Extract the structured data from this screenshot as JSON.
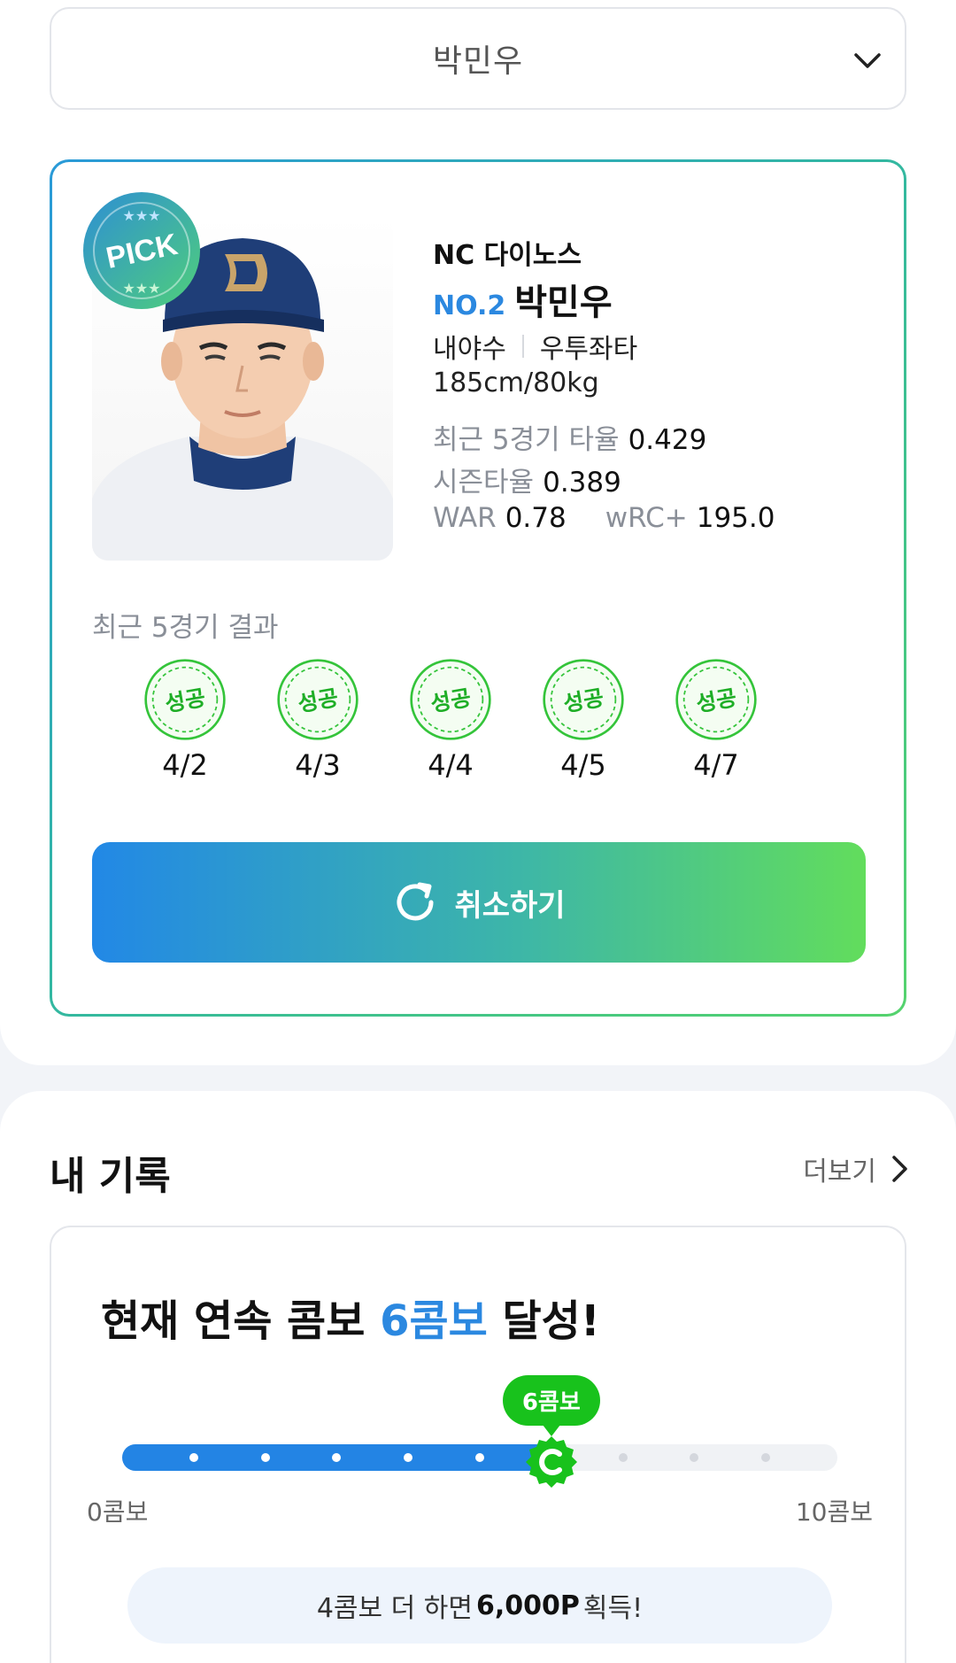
{
  "player_select": {
    "selected": "박민우"
  },
  "player": {
    "team": "NC 다이노스",
    "number": "NO.2",
    "name": "박민우",
    "position": "내야수",
    "batting": "우투좌타",
    "body": "185cm/80kg",
    "badge": "PICK",
    "stats": [
      {
        "label": "최근 5경기 타율",
        "value": "0.429"
      },
      {
        "label": "시즌타율",
        "value": "0.389"
      },
      {
        "label": "WAR",
        "value": "0.78"
      },
      {
        "label": "wRC+",
        "value": "195.0"
      }
    ]
  },
  "recent": {
    "title": "최근 5경기 결과",
    "results": [
      {
        "status": "성공",
        "date": "4/2"
      },
      {
        "status": "성공",
        "date": "4/3"
      },
      {
        "status": "성공",
        "date": "4/4"
      },
      {
        "status": "성공",
        "date": "4/5"
      },
      {
        "status": "성공",
        "date": "4/7"
      }
    ]
  },
  "cancel_button": {
    "label": "취소하기"
  },
  "my_record": {
    "title": "내 기록",
    "more": "더보기",
    "headline_prefix": "현재 연속 콤보 ",
    "headline_accent": "6콤보",
    "headline_suffix": " 달성!",
    "current_combo": 6,
    "max_combo": 10,
    "marker_label": "6콤보",
    "min_label": "0콤보",
    "max_label": "10콤보",
    "reward_prefix": "4콤보 더 하면 ",
    "reward_points": "6,000P",
    "reward_suffix": " 획득!"
  },
  "colors": {
    "accent_blue": "#2b88e0",
    "success_green": "#18c21c",
    "muted_gray": "#8a8f98"
  }
}
